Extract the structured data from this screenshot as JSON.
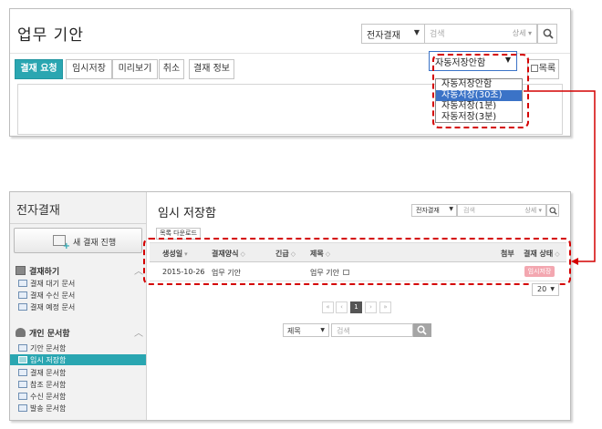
{
  "top": {
    "title": "업무 기안",
    "search_select": "전자결재",
    "search_placeholder": "검색",
    "search_detail": "상세",
    "toolbar": {
      "approve": "결재 요청",
      "temp_save": "임시저장",
      "preview": "미리보기",
      "cancel": "취소",
      "approval_info": "결재 정보",
      "list": "목록"
    },
    "autosave": {
      "selected": "자동저장안함",
      "options": [
        "자동저장안함",
        "자동저장(30초)",
        "자동저장(1분)",
        "자동저장(3분)"
      ],
      "highlighted_index": 1
    }
  },
  "bottom": {
    "sidebar": {
      "title": "전자결재",
      "new_button": "새 결재 진행",
      "section1": {
        "title": "결재하기",
        "items": [
          "결재 대기 문서",
          "결재 수신 문서",
          "결재 예정 문서"
        ]
      },
      "section2": {
        "title": "개인 문서함",
        "items": [
          "기안 문서함",
          "임시 저장함",
          "결재 문서함",
          "참조 문서함",
          "수신 문서함",
          "발송 문서함"
        ],
        "active_index": 1
      }
    },
    "content": {
      "title": "임시 저장함",
      "search_select": "전자결재",
      "search_placeholder": "검색",
      "search_detail": "상세",
      "download_button": "목록 다운로드",
      "columns": [
        "생성일",
        "결재양식",
        "긴급",
        "제목",
        "첨부",
        "결재 상태"
      ],
      "rows": [
        {
          "date": "2015-10-26",
          "form": "업무 기안",
          "urgent": "",
          "subject": "업무 기안",
          "attach": "",
          "status": "임시저장"
        }
      ],
      "page_size": "20",
      "pagination": {
        "current": "1",
        "first": "«",
        "prev": "‹",
        "next": "›",
        "last": "»"
      },
      "bottom_search": {
        "select": "제목",
        "placeholder": "검색"
      }
    }
  },
  "colors": {
    "accent": "#2aa6b1",
    "highlight": "#3b73c7",
    "callout": "#d40000",
    "status_badge": "#f3a7b0"
  }
}
